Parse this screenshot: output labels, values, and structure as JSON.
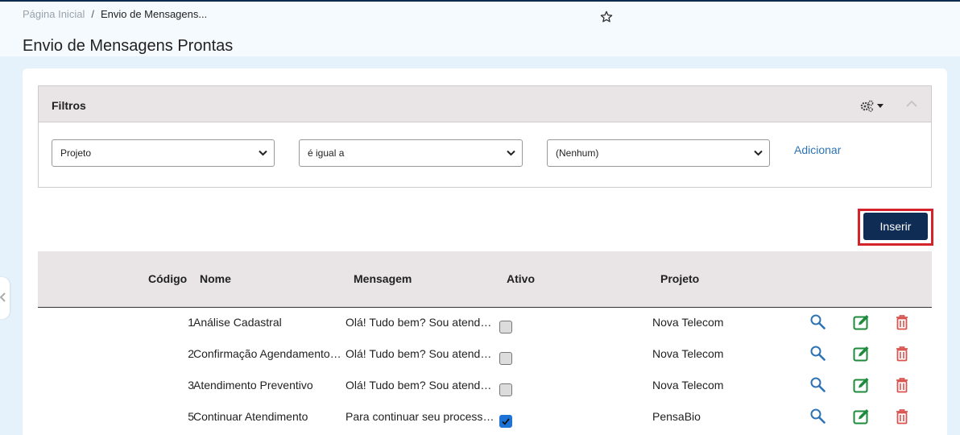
{
  "breadcrumb": {
    "home": "Página Inicial",
    "separator": "/",
    "current": "Envio de Mensagens..."
  },
  "page": {
    "title": "Envio de Mensagens Prontas"
  },
  "filters": {
    "title": "Filtros",
    "field": "Projeto",
    "operator": "é igual a",
    "value": "(Nenhum)",
    "add_label": "Adicionar"
  },
  "toolbar": {
    "insert_label": "Inserir"
  },
  "table": {
    "columns": {
      "code": "Código",
      "name": "Nome",
      "message": "Mensagem",
      "active": "Ativo",
      "project": "Projeto"
    },
    "rows": [
      {
        "code": "1",
        "name": "Análise Cadastral",
        "message": "Olá! Tudo bem? Sou atendente",
        "active": false,
        "project": "Nova Telecom"
      },
      {
        "code": "2",
        "name": "Confirmação Agendamento Instalação",
        "message": "Olá! Tudo bem? Sou atendente",
        "active": false,
        "project": "Nova Telecom"
      },
      {
        "code": "3",
        "name": "Atendimento Preventivo",
        "message": "Olá! Tudo bem? Sou atendente",
        "active": false,
        "project": "Nova Telecom"
      },
      {
        "code": "5",
        "name": "Continuar Atendimento",
        "message": "Para continuar seu processo de",
        "active": true,
        "project": "PensaBio"
      }
    ]
  },
  "colors": {
    "primary": "#0f2c55",
    "highlight": "#d4232b",
    "link": "#2d73b4",
    "view": "#2d73b4",
    "edit": "#1e8a3c",
    "delete": "#d9534f",
    "checkbox_on": "#1e74d6"
  }
}
